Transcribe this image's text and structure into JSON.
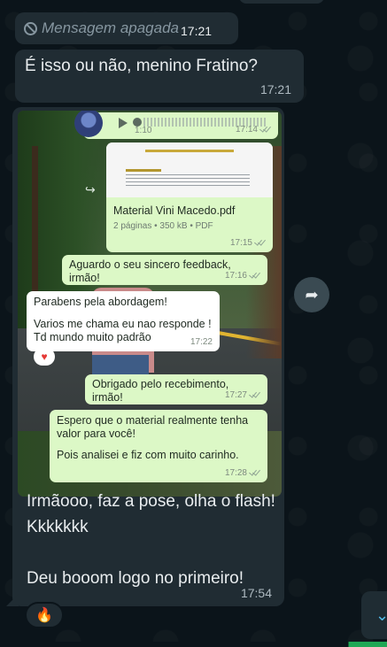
{
  "chat": {
    "deleted": {
      "label": "Mensagem apagada",
      "time": "17:21"
    },
    "question": {
      "text": "É isso ou não, menino Fratino?",
      "time": "17:21"
    },
    "photo_message": {
      "embedded": {
        "audio": {
          "duration": "1:10",
          "time": "17:14"
        },
        "pdf": {
          "name": "Material Vini Macedo.pdf",
          "meta": "2 páginas • 350 kB • PDF",
          "time": "17:15"
        },
        "aguardo": {
          "text": "Aguardo o seu sincero feedback, irmão!",
          "time": "17:16"
        },
        "parabens": {
          "line1": "Parabens pela abordagem!",
          "line2": "Varios me chama eu nao responde !",
          "line3": "Td mundo muito padrão",
          "time": "17:22",
          "reaction": "♥"
        },
        "obrigado": {
          "text": "Obrigado pelo recebimento, irmão!",
          "time": "17:27"
        },
        "espero": {
          "line1": "Espero que o material realmente tenha",
          "line2": "valor para você!",
          "line3": "Pois analisei e fiz com muito carinho.",
          "time": "17:28"
        }
      },
      "caption_line1": "Irmãooo, faz a pose, olha o flash! Kkkkkkk",
      "caption_line2": "Deu booom logo no primeiro!",
      "time": "17:54",
      "reaction": "🔥"
    }
  },
  "icons": {
    "deleted": "ban-icon",
    "forward": "share-icon",
    "scroll": "chevron-down-icon"
  },
  "colors": {
    "background": "#0b141a",
    "incoming_bubble": "#202c33",
    "sent_bubble_embedded": "#dcf8c6",
    "accent": "#53bdeb"
  }
}
